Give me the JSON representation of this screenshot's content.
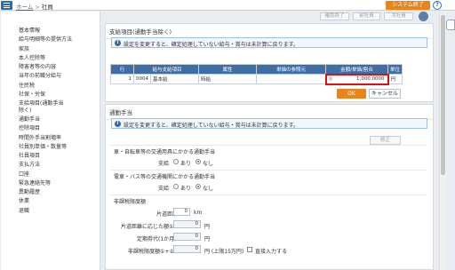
{
  "header": {
    "home": "ホーム",
    "separator": ">",
    "current": "社員",
    "system_end": "システム終了",
    "help": "?"
  },
  "toolbar": {
    "confirm": "確認終了",
    "prev": "前社員",
    "next": "次社員"
  },
  "sidebar": {
    "items": [
      "基本情報",
      "給与明細等の提供方法",
      "家族",
      "本人控除等",
      "障害者等の内容",
      "当年の前職分給与",
      "住民税",
      "社保・労保",
      "支給項目(通勤手当除く)",
      "通勤手当",
      "控除項目",
      "時間外手当割増率",
      "社員別単価・数量等",
      "社員項目",
      "支払方法",
      "口座",
      "緊急連絡先等",
      "異動履歴",
      "休業",
      "退職"
    ]
  },
  "pay_section": {
    "title": "支給項目(通勤手当除く)",
    "info": "設定を変更すると、確定処理していない給与・賞与は未計算に戻ります。",
    "headers": [
      "行",
      "給与支給項目",
      "",
      "属性",
      "単価の参照元",
      "金額/単価/割合",
      "単位"
    ],
    "row": {
      "no": "1",
      "code": "0004",
      "name": "基本給",
      "attr": "時給",
      "ref": "",
      "flag": "◎",
      "amount": "1,000.0000",
      "unit": "円"
    },
    "ok": "OK",
    "cancel": "キャンセル"
  },
  "commute_section": {
    "title": "通勤手当",
    "info": "設定を変更すると、確定処理していない給与・賞与は未計算に戻ります。",
    "fix": "修正",
    "car_heading": "車・自転車等の交通用具にかかる通勤手当",
    "train_heading": "電車・バス等の交通機関にかかる通勤手当",
    "pay_label": "支給",
    "yes": "あり",
    "no": "なし",
    "tax_heading": "非課税限度額",
    "distance_label": "片道距離",
    "distance_value": "0",
    "distance_unit": "km",
    "distance_amount_label": "片道距離に応じた額①",
    "distance_amount_value": "0",
    "pass_label": "定期券代(1か月)②",
    "pass_value": "0",
    "limit_label": "非課税限度額①+②",
    "limit_value": "0",
    "limit_unit": "円 (上限15万円)",
    "direct_input": "直接入力する",
    "yen": "円"
  }
}
